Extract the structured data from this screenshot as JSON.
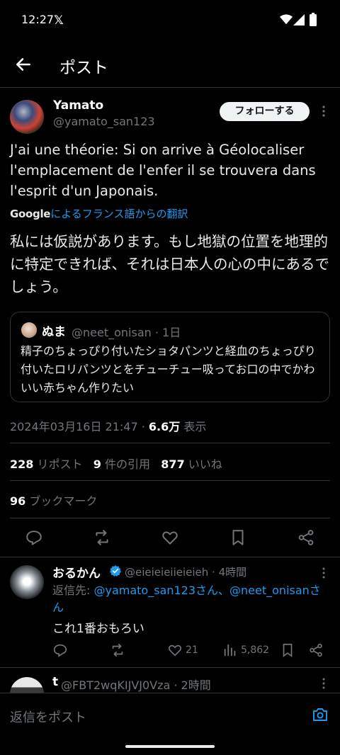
{
  "status_bar": {
    "time": "12:27",
    "app_icon": "x-logo-icon",
    "x_glyph": "𝕏",
    "icons": [
      "wifi-icon",
      "signal-icon",
      "battery-icon"
    ]
  },
  "header": {
    "back_icon": "arrow-left-icon",
    "title": "ポスト"
  },
  "tweet": {
    "author_name": "Yamato",
    "author_handle": "@yamato_san123",
    "follow_label": "フォローする",
    "text": "J'ai une théorie: Si on arrive à Géolocaliser l'emplacement de l'enfer il se trouvera dans l'esprit d'un Japonais.",
    "translate_brand": "Google",
    "translate_label": "によるフランス語からの翻訳",
    "translated_text": "私には仮説があります。もし地獄の位置を地理的に特定できれば、それは日本人の心の中にあるでしょう。",
    "quote": {
      "name": "ぬま",
      "handle_time": "@neet_onisan · 1日",
      "text": "精子のちょっぴり付いたショタパンツと経血のちょっぴり付いたロリパンツとをチューチュー吸ってお口の中でかわいい赤ちゃん作りたい"
    },
    "timestamp": "2024年03月16日 21:47 · ",
    "views_count": "6.6万",
    "views_label": " 表示",
    "reposts_count": "228",
    "reposts_label": "リポスト",
    "quotes_count": "9",
    "quotes_label": "件の引用",
    "likes_count": "877",
    "likes_label": "いいね",
    "bookmarks_count": "96",
    "bookmarks_label": "ブックマーク"
  },
  "reply": {
    "name": "おるかん",
    "handle_time": "@eieieieiieieieh · 4時間",
    "reply_to_prefix": "返信先: ",
    "reply_to_mentions": "@yamato_san123さん、@neet_onisanさん",
    "text": "これ1番おもろい",
    "likes": "21",
    "views": "5,862"
  },
  "next_reply": {
    "name": "t",
    "handle_time": "@FBT2wqKIJVJ0Vza · 2時間"
  },
  "compose": {
    "placeholder": "返信をポスト",
    "camera_icon": "camera-icon"
  },
  "colors": {
    "accent": "#1d9bf0",
    "muted": "#71767b",
    "background": "#000000",
    "border": "#2f3336"
  }
}
